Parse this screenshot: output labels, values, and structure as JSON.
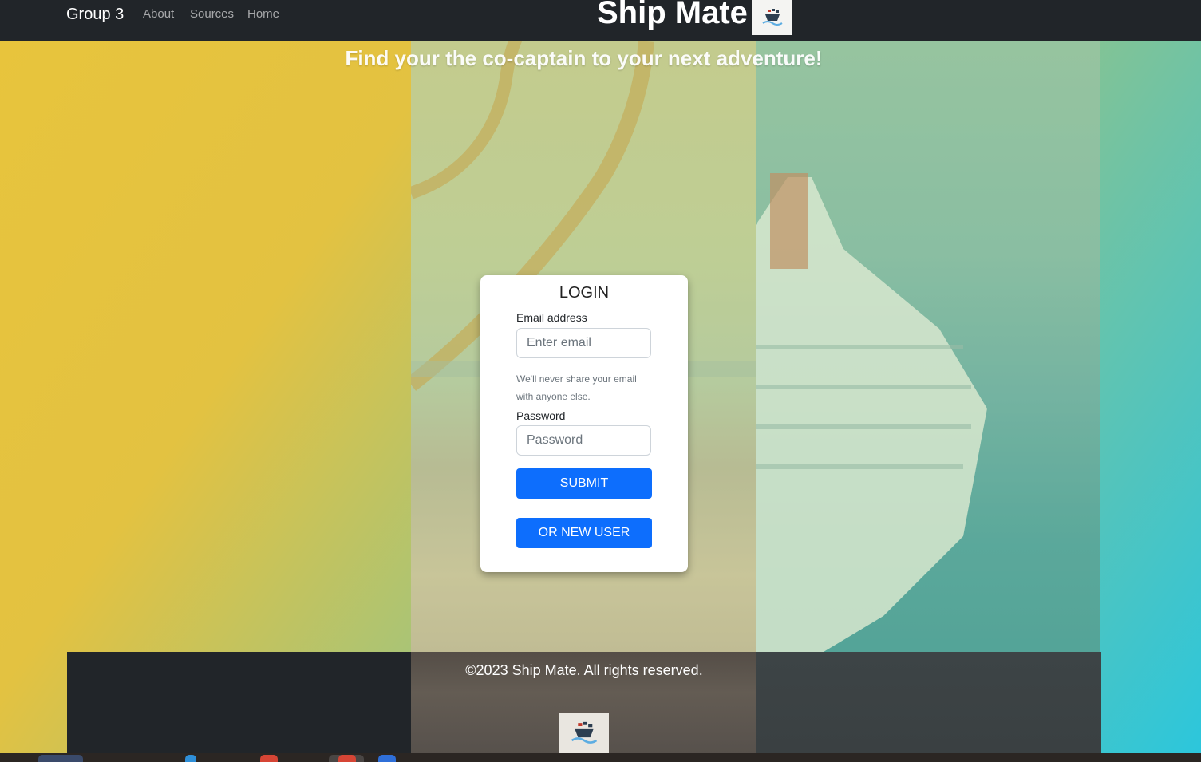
{
  "navbar": {
    "brand": "Group 3",
    "links": [
      "About",
      "Sources",
      "Home"
    ],
    "site_title": "Ship Mate",
    "logo_icon": "ship-logo-icon"
  },
  "hero": {
    "tagline": "Find your the co-captain to your next adventure!"
  },
  "login": {
    "title": "LOGIN",
    "email_label": "Email address",
    "email_placeholder": "Enter email",
    "email_value": "",
    "email_help": "We'll never share your email with anyone else.",
    "password_label": "Password",
    "password_placeholder": "Password",
    "password_value": "",
    "submit_label": "SUBMIT",
    "new_user_label": "OR NEW USER"
  },
  "footer": {
    "copyright": "©2023 Ship Mate. All rights reserved.",
    "logo_icon": "ship-logo-icon"
  },
  "colors": {
    "navbar": "#212529",
    "primary_button": "#0d6efd",
    "gradient_start": "#e8c43c",
    "gradient_end": "#2cc6dc"
  }
}
